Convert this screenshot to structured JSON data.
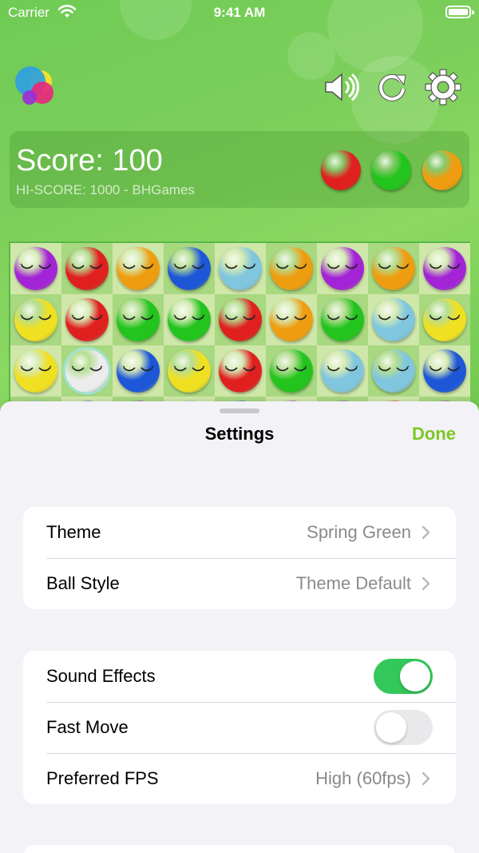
{
  "status_bar": {
    "carrier": "Carrier",
    "time": "9:41 AM"
  },
  "toolbar": {
    "logo_icon": "app-logo-icon",
    "sound_icon": "speaker-icon",
    "restart_icon": "restart-icon",
    "settings_icon": "gear-icon"
  },
  "score": {
    "label": "Score: 100",
    "hi_score": "HI-SCORE: 1000 - BHGames",
    "next_balls": [
      "red",
      "green",
      "orange"
    ]
  },
  "colors": {
    "red": "#e0201f",
    "green": "#22c41d",
    "orange": "#ee9d10",
    "purple": "#a324d6",
    "blue": "#1d57d8",
    "cyan": "#7fc6de",
    "yellow": "#f0e022",
    "white": "#ececec",
    "accent": "#7dc724",
    "toggle_on": "#34c759"
  },
  "board": {
    "rows": [
      [
        "purple",
        "red",
        "orange",
        "blue",
        "cyan",
        "orange",
        "purple",
        "orange",
        "purple"
      ],
      [
        "yellow",
        "red",
        "green",
        "green",
        "red",
        "orange",
        "green",
        "cyan",
        "yellow"
      ],
      [
        "yellow",
        "white",
        "blue",
        "yellow",
        "red",
        "green",
        "cyan",
        "cyan",
        "blue"
      ],
      [
        "cyan",
        "blue",
        "purple",
        "cyan",
        "blue",
        "purple",
        "purple",
        "red",
        "purple"
      ]
    ],
    "selected": [
      2,
      1
    ]
  },
  "settings": {
    "title": "Settings",
    "done": "Done",
    "group1": [
      {
        "label": "Theme",
        "value": "Spring Green"
      },
      {
        "label": "Ball Style",
        "value": "Theme Default"
      }
    ],
    "group2": {
      "sound_effects": {
        "label": "Sound Effects",
        "on": true
      },
      "fast_move": {
        "label": "Fast Move",
        "on": false
      },
      "fps": {
        "label": "Preferred FPS",
        "value": "High (60fps)"
      }
    }
  }
}
